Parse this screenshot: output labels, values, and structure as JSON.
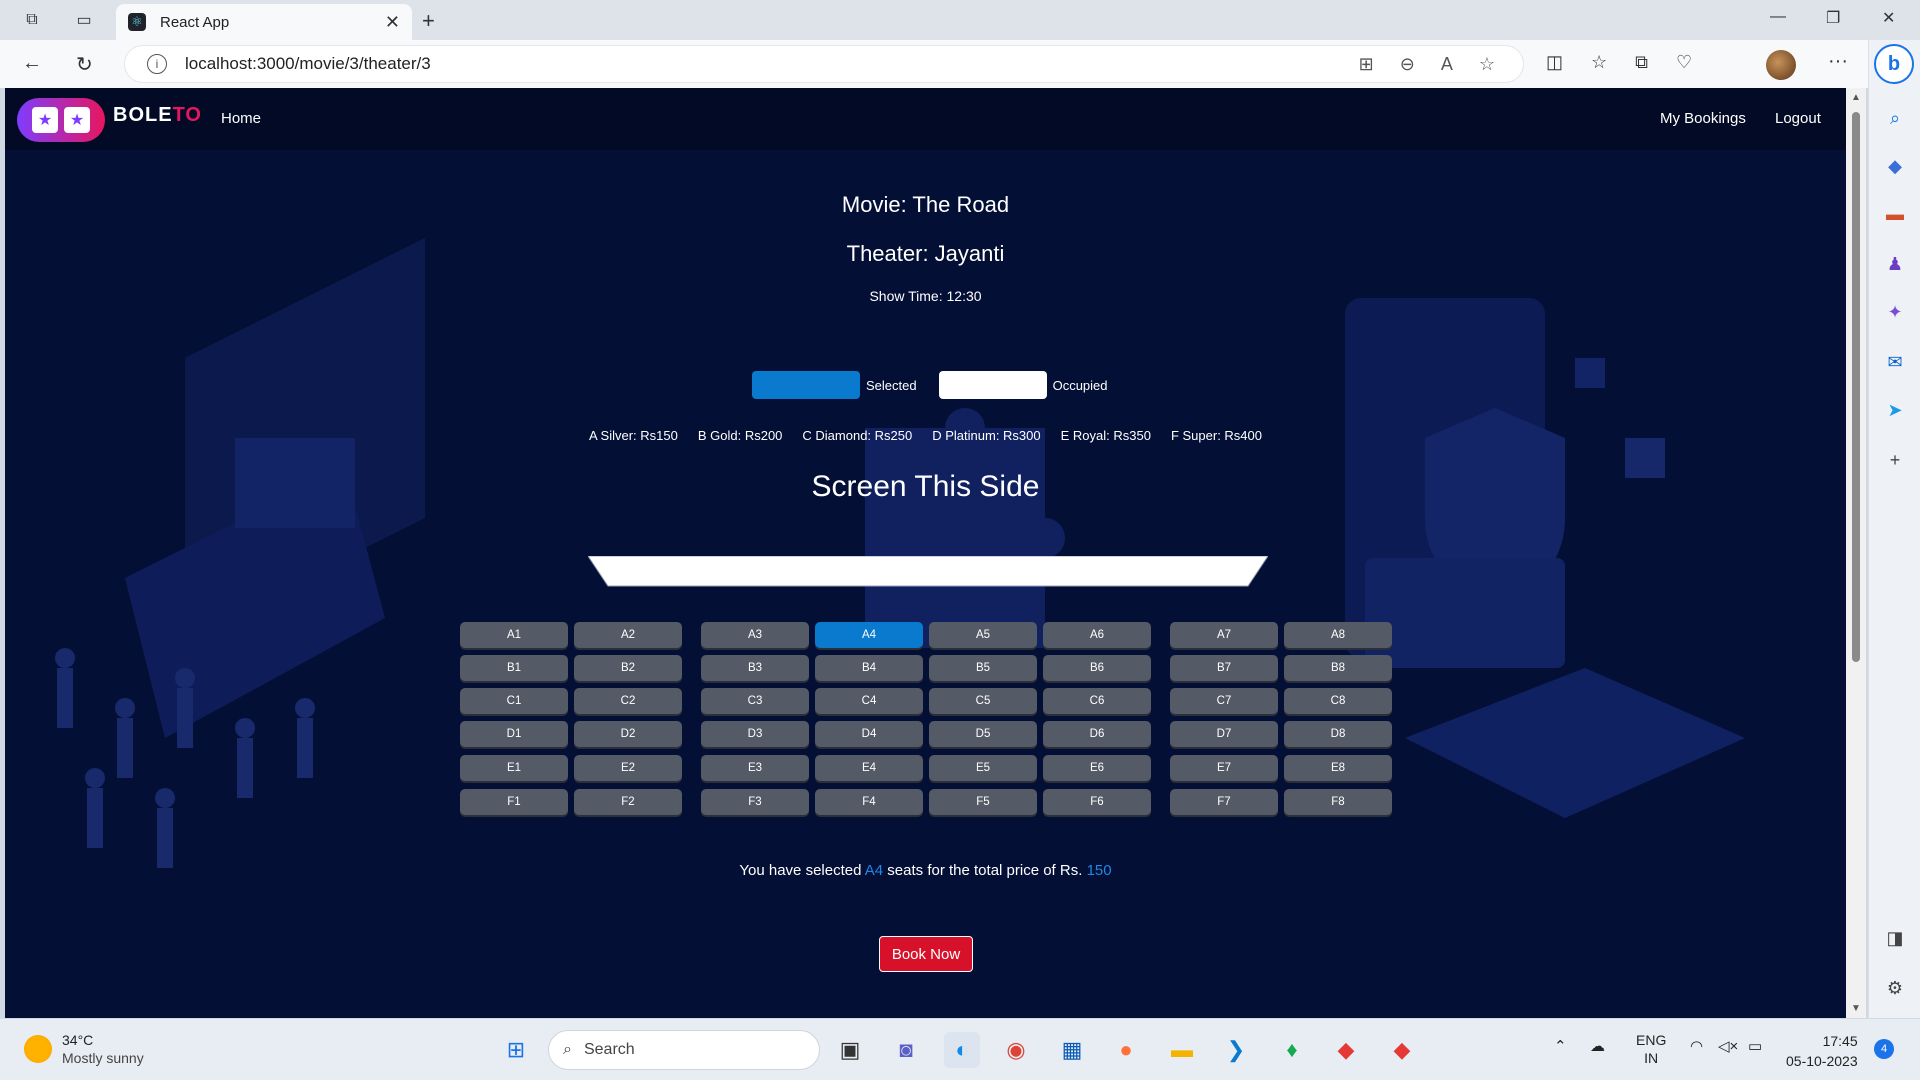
{
  "browser": {
    "tab_title": "React App",
    "url": "localhost:3000/movie/3/theater/3"
  },
  "navbar": {
    "brand_main": "BOLE",
    "brand_accent": "TO",
    "home": "Home",
    "my_bookings": "My Bookings",
    "logout": "Logout"
  },
  "show": {
    "movie": "Movie: The Road",
    "theater": "Theater: Jayanti",
    "show_time": "Show Time: 12:30"
  },
  "legend": {
    "selected_label": "Selected",
    "occupied_label": "Occupied",
    "selected_color": "#0a7acf",
    "occupied_color": "#ffffff"
  },
  "prices": [
    "A Silver: Rs150",
    "B Gold: Rs200",
    "C Diamond: Rs250",
    "D Platinum: Rs300",
    "E Royal: Rs350",
    "F Super: Rs400"
  ],
  "screen_label": "Screen This Side",
  "seats": {
    "rows": [
      "A",
      "B",
      "C",
      "D",
      "E",
      "F"
    ],
    "cols": [
      1,
      2,
      3,
      4,
      5,
      6,
      7,
      8
    ],
    "selected": [
      "A4"
    ]
  },
  "summary": {
    "prefix": "You have selected ",
    "seats": "A4",
    "middle": " seats for the total price of Rs. ",
    "price": "150"
  },
  "book_button": "Book Now",
  "taskbar": {
    "temp": "34°C",
    "weather": "Mostly sunny",
    "search": "Search",
    "lang1": "ENG",
    "lang2": "IN",
    "time": "17:45",
    "date": "05-10-2023",
    "notifications": "4"
  }
}
